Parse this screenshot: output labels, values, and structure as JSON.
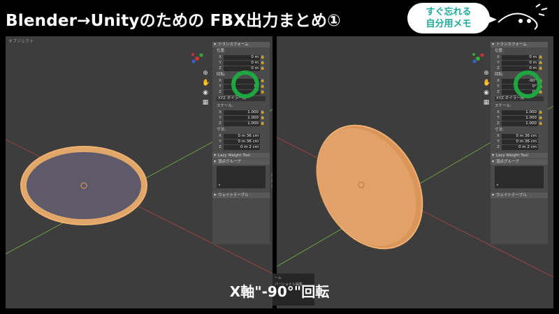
{
  "header": {
    "title": "Blender→Unityのための FBX出力まとめ①",
    "bubble_line1": "すぐ忘れる",
    "bubble_line2": "自分用メモ"
  },
  "viewport_label": "オブジェクト",
  "panel": {
    "transform_header": "トランスフォーム",
    "location_label": "位置:",
    "rotation_label": "回転:",
    "rotation_mode": "XYZ オイラー角",
    "scale_label": "スケール:",
    "dimensions_label": "寸法:",
    "axes": [
      "X",
      "Y",
      "Z"
    ],
    "location_values": [
      "0 m",
      "0 m",
      "0 m"
    ],
    "scale_values": [
      "1.000",
      "1.000",
      "1.000"
    ],
    "dimensions_values": [
      "0 m 36 cm",
      "0 m 36 cm",
      "0 m 2 cm"
    ],
    "lazy_weight_tool": "Lazy Weight Tool",
    "vertex_groups": "頂点グループ",
    "weight_table": "ウェイトテーブル"
  },
  "left_panel": {
    "rotation_values": [
      "0°",
      "0°",
      "0°"
    ]
  },
  "right_panel": {
    "rotation_values": [
      "-90°",
      "0°",
      "0°"
    ]
  },
  "bottom_fragment": [
    "ール",
    "パーショナル編集"
  ],
  "caption": "X軸\"-90°\"回転",
  "colors": {
    "accent_green": "#1fa641",
    "object_orange": "#e8a060",
    "bubble_text": "#1fa99a",
    "viewport_bg": "#3d3d3d"
  }
}
